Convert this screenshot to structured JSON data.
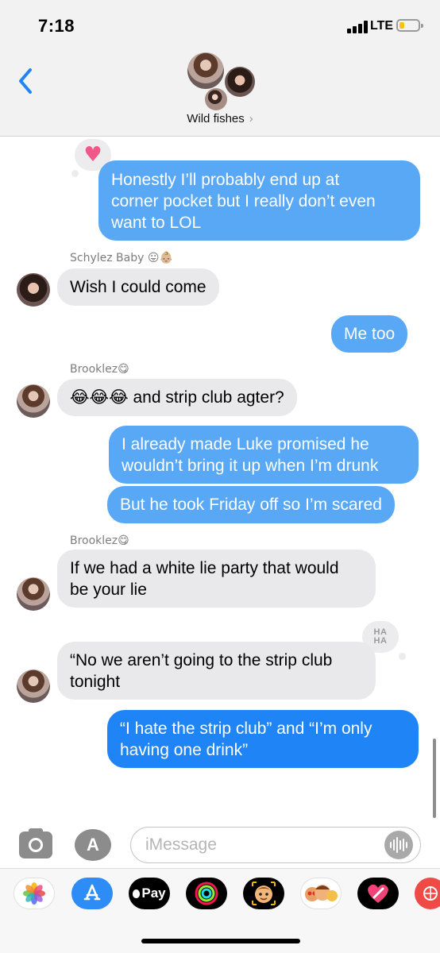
{
  "status": {
    "time": "7:18",
    "network": "LTE"
  },
  "header": {
    "group_name": "Wild fishes",
    "chevron": "›"
  },
  "messages": {
    "m1": {
      "line1": "Honestly I’ll probably end up at",
      "line2": "corner pocket but I really don’t even",
      "line3": "want to LOL"
    },
    "sender1": "Schylez Baby 😛👶🏼",
    "m2": "Wish I could come",
    "m3": "Me too",
    "sender2": "Brooklez😋",
    "m4_emoji": "😂😂😂",
    "m4_text": " and strip club agter?",
    "m5": {
      "line1": "I already made Luke promised he",
      "line2": "wouldn’t bring it up when I’m drunk"
    },
    "m6": "But he took Friday off so I’m scared",
    "sender3": "Brooklez😋",
    "m7": {
      "line1": "If we had a white lie party that would",
      "line2": "be your lie"
    },
    "m8": {
      "line1": "“No we aren’t going to the strip club",
      "line2": "tonight"
    },
    "m9": {
      "line1": "“I hate the strip club” and “I’m only",
      "line2": "having one drink”"
    },
    "tapback_heart": "♥",
    "tapback_haha": {
      "line1": "HA",
      "line2": "HA"
    }
  },
  "input": {
    "placeholder": "iMessage",
    "apps_glyph": "A"
  },
  "drawer": {
    "pay_label": "Pay",
    "apple_glyph": ""
  },
  "colors": {
    "sent_light": "#58a8f5",
    "sent_blue": "#1f84f6",
    "received": "#e9e9eb",
    "ios_blue": "#1f84f6"
  }
}
